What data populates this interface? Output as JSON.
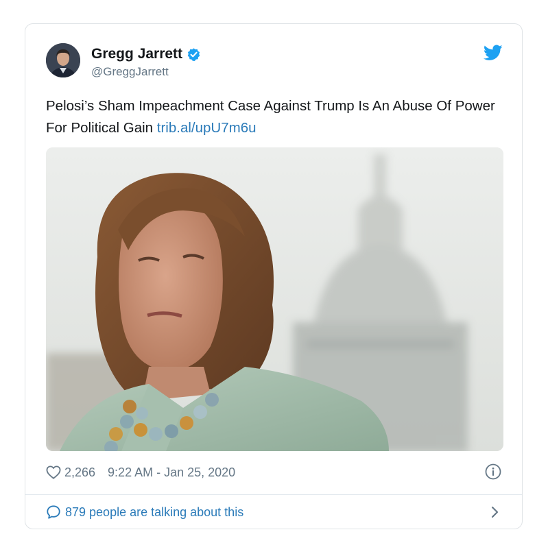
{
  "tweet": {
    "author": {
      "display_name": "Gregg Jarrett",
      "handle": "@GreggJarrett",
      "verified": true
    },
    "text": "Pelosi’s Sham Impeachment Case Against Trump Is An Abuse Of Power For Political Gain ",
    "link_text": "trib.al/upU7m6u",
    "likes": "2,266",
    "timestamp": "9:22 AM - Jan 25, 2020",
    "conversation_text": "879 people are talking about this"
  },
  "icons": {
    "brand": "twitter-bird-icon",
    "verified": "verified-badge-icon",
    "like": "heart-icon",
    "info": "info-icon",
    "conversation": "speech-bubble-icon",
    "more": "chevron-right-icon"
  },
  "colors": {
    "brand_blue": "#1da1f2",
    "link_blue": "#2b7bb9",
    "text_primary": "#14171a",
    "text_secondary": "#657786",
    "border": "#dfe3e6"
  }
}
